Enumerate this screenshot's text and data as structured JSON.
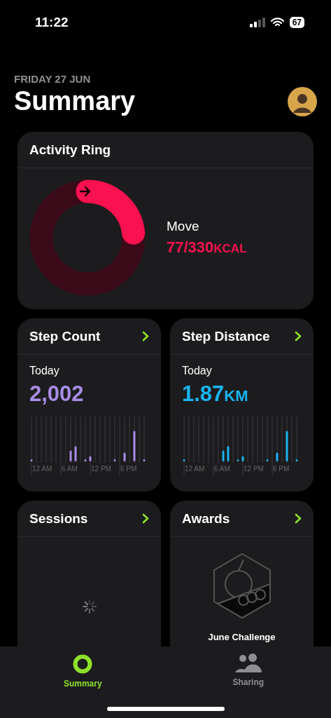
{
  "status_bar": {
    "time": "11:22",
    "battery": "67"
  },
  "header": {
    "date": "FRIDAY 27 JUN",
    "title": "Summary"
  },
  "activity_ring": {
    "title": "Activity Ring",
    "label": "Move",
    "value": "77/330",
    "unit": "KCAL",
    "level": 0.233
  },
  "metrics": [
    {
      "title": "Step Count",
      "period": "Today",
      "value": "2,002",
      "color": "#a98ce6",
      "axis_labels": [
        "12 AM",
        "6 AM",
        "12 PM",
        "6 PM"
      ]
    },
    {
      "title": "Step Distance",
      "period": "Today",
      "value": "1.87",
      "unit": "KM",
      "color": "#1ab3f0",
      "axis_labels": [
        "12 AM",
        "6 AM",
        "12 PM",
        "6 PM"
      ]
    }
  ],
  "tiles": [
    {
      "title": "Sessions",
      "kind": "loading"
    },
    {
      "title": "Awards",
      "kind": "award",
      "caption": "June Challenge"
    }
  ],
  "tabs": [
    {
      "label": "Summary",
      "selected": true
    },
    {
      "label": "Sharing",
      "selected": false
    }
  ]
}
